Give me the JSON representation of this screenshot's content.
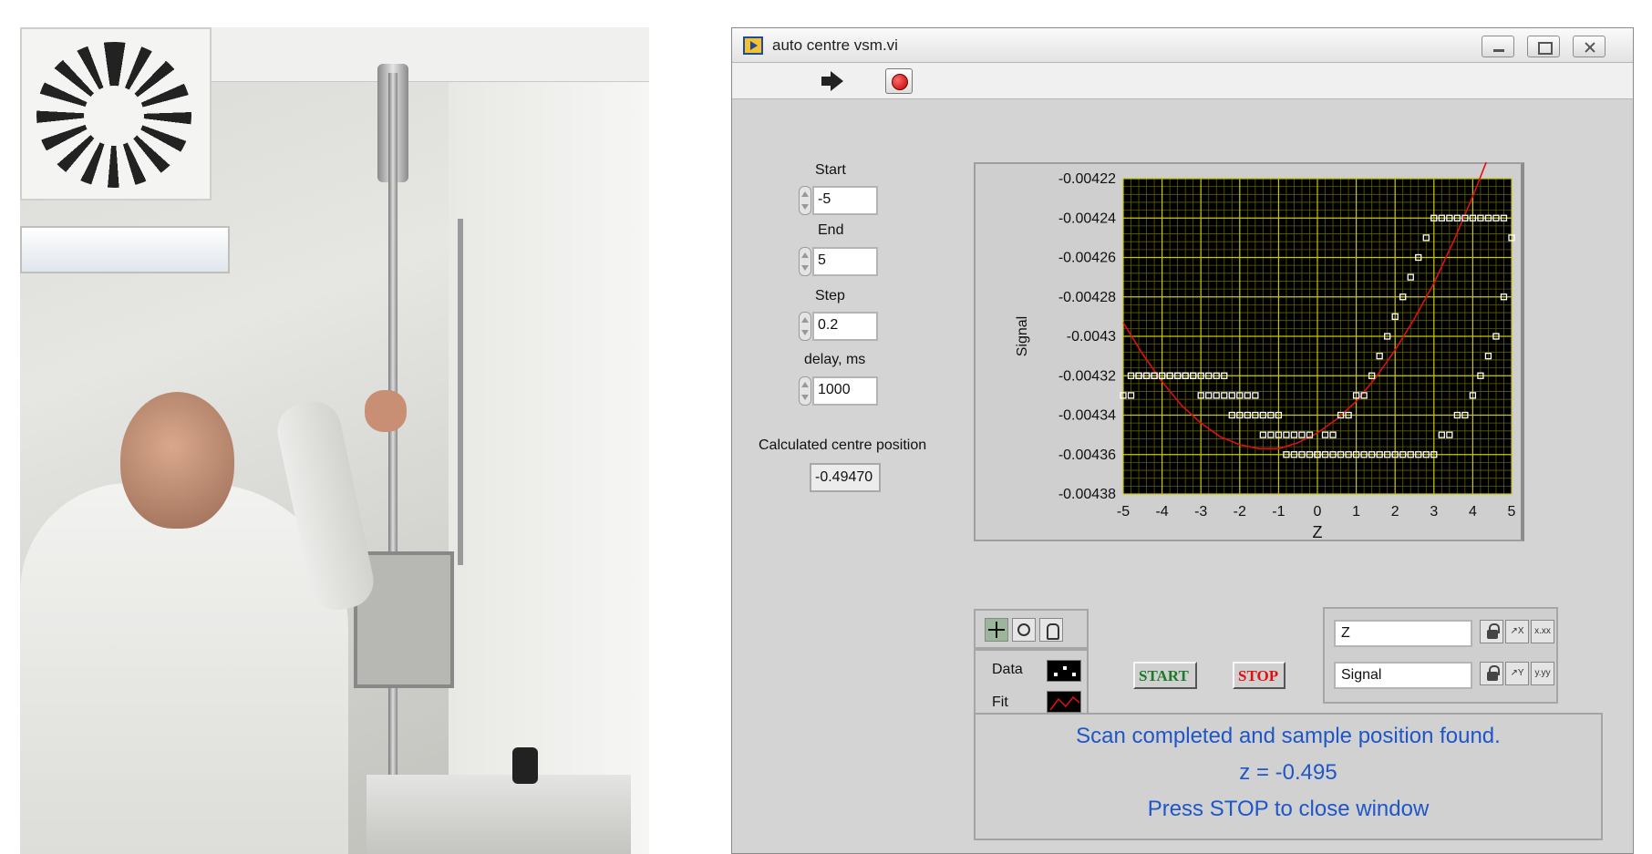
{
  "window": {
    "title": "auto centre vsm.vi"
  },
  "toolbar": {
    "run_icon": "run-arrow-icon",
    "stop_icon": "abort-stop-icon"
  },
  "controls": {
    "start_label": "Start",
    "start_value": "-5",
    "end_label": "End",
    "end_value": "5",
    "step_label": "Step",
    "step_value": "0.2",
    "delay_label": "delay, ms",
    "delay_value": "1000",
    "centre_label": "Calculated centre position",
    "centre_value": "-0.49470"
  },
  "graph": {
    "legend": [
      {
        "label": "Data",
        "style": "points",
        "color": "#ffffff"
      },
      {
        "label": "Fit",
        "style": "line",
        "color": "#e01010"
      }
    ],
    "scale_x_name": "Z",
    "scale_y_name": "Signal",
    "x_format_icon": "x.xx",
    "y_format_icon": "y.yy"
  },
  "buttons": {
    "start_label": "START",
    "stop_label": "STOP"
  },
  "status": {
    "line1": "Scan completed and sample position found.",
    "line2": "z = -0.495",
    "line3": "Press STOP to close window"
  },
  "colors": {
    "plot_bg": "#000000",
    "grid_major": "#c8c800",
    "grid_minor": "#5f5f00",
    "fit": "#e01010",
    "status_text": "#1f56c8",
    "start_text": "#1c7a2a",
    "stop_text": "#e01010"
  },
  "chart_data": {
    "type": "scatter",
    "title": "",
    "xlabel": "Z",
    "ylabel": "Signal",
    "xlim": [
      -5,
      5
    ],
    "ylim": [
      -0.00438,
      -0.00422
    ],
    "x_ticks": [
      -5,
      -4,
      -3,
      -2,
      -1,
      0,
      1,
      2,
      3,
      4,
      5
    ],
    "y_ticks": [
      -0.00422,
      -0.00424,
      -0.00426,
      -0.00428,
      -0.0043,
      -0.00432,
      -0.00434,
      -0.00436,
      -0.00438
    ],
    "y_tick_labels": [
      "-0.00422",
      "-0.00424",
      "-0.00426",
      "-0.00428",
      "-0.0043",
      "-0.00432",
      "-0.00434",
      "-0.00436",
      "-0.00438"
    ],
    "grid": true,
    "series": [
      {
        "name": "Data",
        "style": "points",
        "x": [
          -5.0,
          -4.8,
          -4.6,
          -4.4,
          -4.2,
          -4.0,
          -3.8,
          -3.6,
          -3.4,
          -3.2,
          -3.0,
          -2.8,
          -2.6,
          -2.4,
          -2.2,
          -2.0,
          -1.8,
          -1.6,
          -1.4,
          -1.2,
          -1.0,
          -0.8,
          -0.6,
          -0.4,
          -0.2,
          0.0,
          0.2,
          0.4,
          0.6,
          0.8,
          1.0,
          1.2,
          1.4,
          1.6,
          1.8,
          2.0,
          2.2,
          2.4,
          2.6,
          2.8,
          3.0,
          3.2,
          3.4,
          3.6,
          3.8,
          4.0,
          4.2,
          4.4,
          4.6,
          4.8,
          5.0,
          4.8,
          4.6,
          4.4,
          4.2,
          4.0,
          3.8,
          3.6,
          3.4,
          3.2,
          3.0,
          2.8,
          2.6,
          2.4,
          2.2,
          2.0,
          1.8,
          1.6,
          1.4,
          1.2,
          1.0,
          0.8,
          0.6,
          0.4,
          0.2,
          0.0,
          -0.2,
          -0.4,
          -0.6,
          -0.8,
          -1.0,
          -1.2,
          -1.4,
          -1.6,
          -1.8,
          -2.0,
          -2.2,
          -2.4,
          -2.6,
          -2.8,
          -3.0,
          -3.2,
          -3.4,
          -3.6,
          -3.8,
          -4.0,
          -4.2,
          -4.4,
          -4.6,
          -4.8
        ],
        "y": [
          -0.00433,
          -0.00432,
          -0.00432,
          -0.00432,
          -0.00432,
          -0.00432,
          -0.00432,
          -0.00432,
          -0.00432,
          -0.00432,
          -0.00432,
          -0.00432,
          -0.00432,
          -0.00432,
          -0.00433,
          -0.00433,
          -0.00433,
          -0.00433,
          -0.00434,
          -0.00434,
          -0.00434,
          -0.00435,
          -0.00435,
          -0.00435,
          -0.00435,
          -0.00436,
          -0.00435,
          -0.00435,
          -0.00434,
          -0.00434,
          -0.00433,
          -0.00433,
          -0.00432,
          -0.00431,
          -0.0043,
          -0.00429,
          -0.00428,
          -0.00427,
          -0.00426,
          -0.00425,
          -0.00424,
          -0.00424,
          -0.00424,
          -0.00424,
          -0.00424,
          -0.00424,
          -0.00424,
          -0.00424,
          -0.00424,
          -0.00424,
          -0.00425,
          -0.00428,
          -0.0043,
          -0.00431,
          -0.00432,
          -0.00433,
          -0.00434,
          -0.00434,
          -0.00435,
          -0.00435,
          -0.00436,
          -0.00436,
          -0.00436,
          -0.00436,
          -0.00436,
          -0.00436,
          -0.00436,
          -0.00436,
          -0.00436,
          -0.00436,
          -0.00436,
          -0.00436,
          -0.00436,
          -0.00436,
          -0.00436,
          -0.00436,
          -0.00436,
          -0.00436,
          -0.00436,
          -0.00436,
          -0.00435,
          -0.00435,
          -0.00435,
          -0.00434,
          -0.00434,
          -0.00434,
          -0.00434,
          -0.00433,
          -0.00433,
          -0.00433,
          -0.00433,
          -0.00432,
          -0.00432,
          -0.00432,
          -0.00432,
          -0.00432,
          -0.00432,
          -0.00432,
          -0.00432,
          -0.00433
        ]
      },
      {
        "name": "Fit",
        "style": "line",
        "x": [
          -5.0,
          -4.5,
          -4.0,
          -3.5,
          -3.0,
          -2.5,
          -2.0,
          -1.5,
          -1.0,
          -0.5,
          0.0,
          0.5,
          1.0,
          1.5,
          2.0,
          2.5,
          3.0,
          3.5,
          4.0,
          4.5,
          5.0
        ],
        "y": [
          -0.004293,
          -0.004309,
          -0.004323,
          -0.004335,
          -0.004344,
          -0.004351,
          -0.004355,
          -0.004357,
          -0.004357,
          -0.004354,
          -0.004349,
          -0.004342,
          -0.004333,
          -0.004321,
          -0.004307,
          -0.004291,
          -0.004273,
          -0.004252,
          -0.004229,
          -0.004204,
          -0.004177
        ]
      }
    ]
  }
}
